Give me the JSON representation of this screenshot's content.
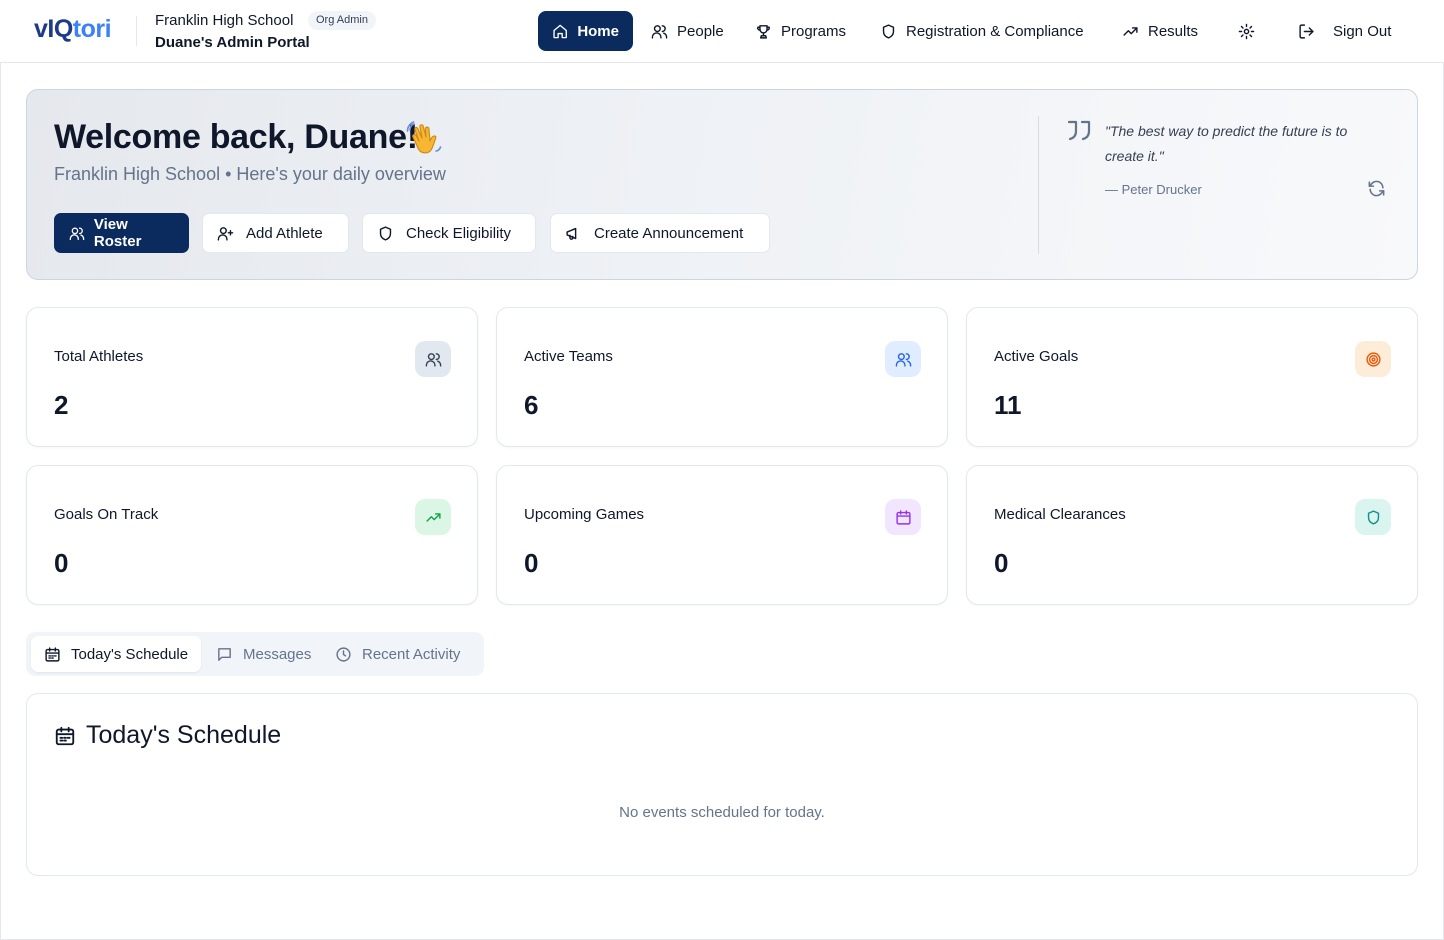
{
  "brand": {
    "logo_part1": "vIQ",
    "logo_part2": "tori"
  },
  "org": {
    "school": "Franklin High School",
    "role_badge": "Org Admin",
    "portal": "Duane's Admin Portal"
  },
  "nav": {
    "home": "Home",
    "people": "People",
    "programs": "Programs",
    "registration": "Registration & Compliance",
    "results": "Results",
    "sign_out": "Sign Out"
  },
  "welcome": {
    "title": "Welcome back, Duane!",
    "subtitle": "Franklin High School • Here's your daily overview",
    "actions": {
      "view_roster": "View Roster",
      "add_athlete": "Add Athlete",
      "check_eligibility": "Check Eligibility",
      "create_announcement": "Create Announcement"
    },
    "quote": {
      "text": "\"The best way to predict the future is to create it.\"",
      "author": "— Peter Drucker"
    }
  },
  "stats": [
    {
      "label": "Total Athletes",
      "value": "2",
      "icon": "users-icon",
      "color": "#334155",
      "bg": "#e2e8f0"
    },
    {
      "label": "Active Teams",
      "value": "6",
      "icon": "users-icon",
      "color": "#2563eb",
      "bg": "#e0ecff"
    },
    {
      "label": "Active Goals",
      "value": "11",
      "icon": "target-icon",
      "color": "#ea580c",
      "bg": "#fdecd8"
    },
    {
      "label": "Goals On Track",
      "value": "0",
      "icon": "trending-up-icon",
      "color": "#16a34a",
      "bg": "#dcf6e6"
    },
    {
      "label": "Upcoming Games",
      "value": "0",
      "icon": "calendar-icon",
      "color": "#9333ea",
      "bg": "#f1e6fd"
    },
    {
      "label": "Medical Clearances",
      "value": "0",
      "icon": "shield-icon",
      "color": "#0d9488",
      "bg": "#daf4ef"
    }
  ],
  "tabs": {
    "schedule": "Today's Schedule",
    "messages": "Messages",
    "activity": "Recent Activity"
  },
  "schedule": {
    "title": "Today's Schedule",
    "empty": "No events scheduled for today."
  }
}
